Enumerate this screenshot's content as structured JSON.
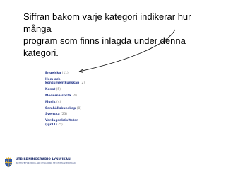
{
  "caption": {
    "line1": "Siffran bakom varje kategori indikerar hur många",
    "line2": "program som finns inlagda under denna kategori."
  },
  "categories": [
    {
      "lines": [
        "Engelska"
      ],
      "count": "(11)"
    },
    {
      "lines": [
        "Hem och",
        "konsumentkunskap"
      ],
      "count": "(2)"
    },
    {
      "lines": [
        "Konst"
      ],
      "count": "(5)"
    },
    {
      "lines": [
        "Moderna språk"
      ],
      "count": "(4)"
    },
    {
      "lines": [
        "Musik"
      ],
      "count": "(4)"
    },
    {
      "lines": [
        "Samhällskunskap"
      ],
      "count": "(8)"
    },
    {
      "lines": [
        "Svenska"
      ],
      "count": "(23)"
    },
    {
      "lines": [
        "Vardagsaktiviteter",
        "(lgr11)"
      ],
      "count": "(5)"
    }
  ],
  "footer": {
    "org_name": "UTBILDNINGSRADIO LYNWIKAN",
    "org_sub": "INSTITUTE FOR MEDIA AND UTBILDNING NED EVSTA SVENNSKAN"
  },
  "colors": {
    "category_label": "#2b3d8f",
    "category_count": "#7a7a7a",
    "brand": "#1f2f6e",
    "crest_gold": "#e0b23a"
  },
  "icons": {
    "crest": "crown-shield-crest-icon",
    "pointer": "pointer-arrow-icon"
  }
}
